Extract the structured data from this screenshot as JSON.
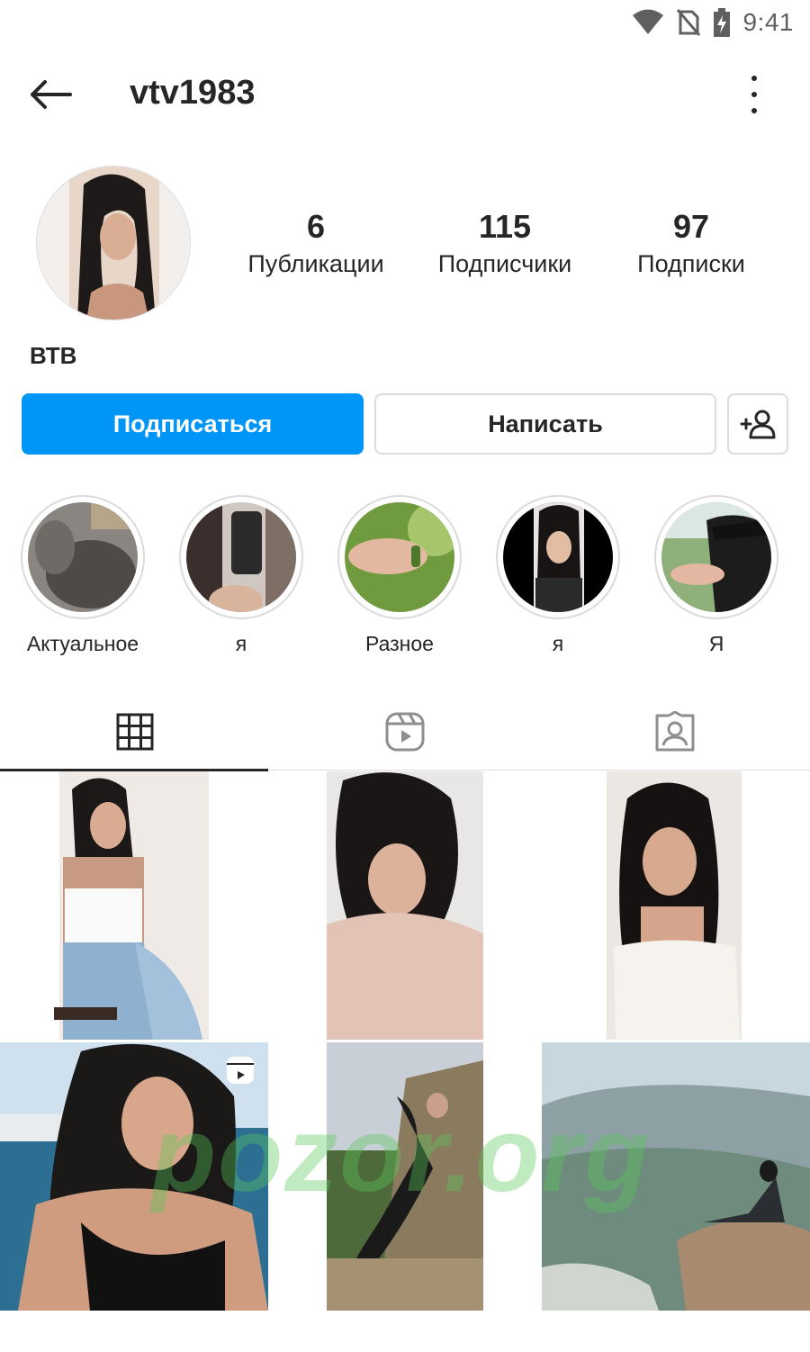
{
  "status_bar": {
    "time": "9:41",
    "icons": [
      "wifi-icon",
      "no-sim-icon",
      "battery-charging-icon"
    ]
  },
  "header": {
    "username": "vtv1983"
  },
  "profile": {
    "full_name": "ВТВ",
    "stats": [
      {
        "value": "6",
        "label": "Публикации"
      },
      {
        "value": "115",
        "label": "Подписчики"
      },
      {
        "value": "97",
        "label": "Подписки"
      }
    ]
  },
  "actions": {
    "follow": "Подписаться",
    "message": "Написать"
  },
  "highlights": [
    {
      "label": "Актуальное"
    },
    {
      "label": "я"
    },
    {
      "label": "Разное"
    },
    {
      "label": "я"
    },
    {
      "label": "Я"
    }
  ],
  "tabs": [
    "grid-icon",
    "reels-icon",
    "tagged-icon"
  ],
  "watermark": "pozor.org",
  "colors": {
    "accent": "#0095f6",
    "text": "#262626",
    "border": "#dbdbdb"
  }
}
